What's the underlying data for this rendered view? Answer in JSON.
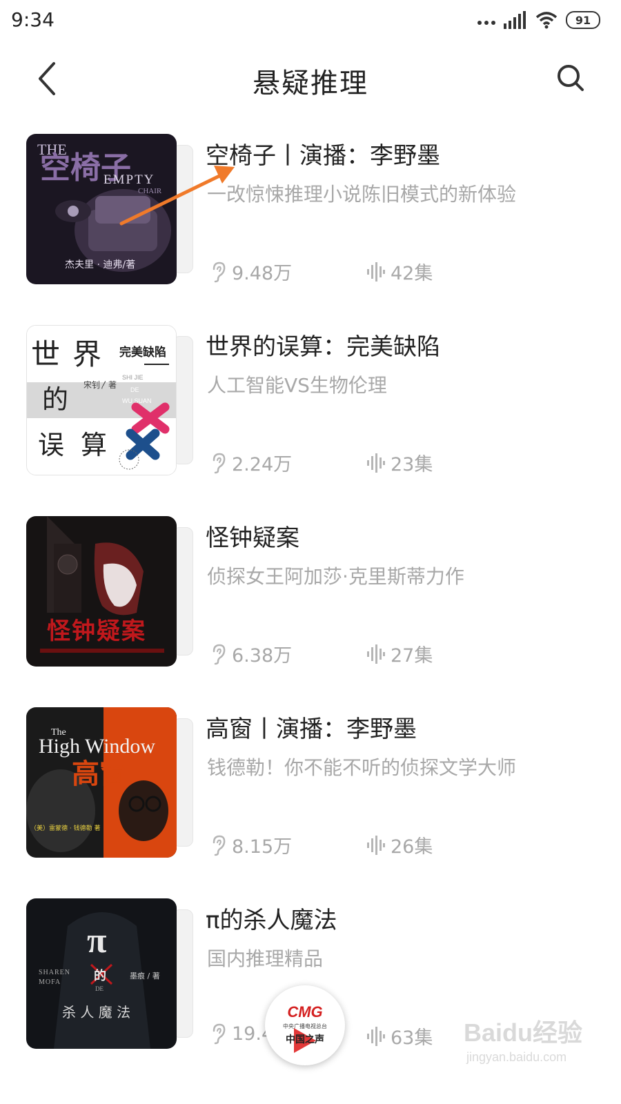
{
  "status_bar": {
    "time": "9:34",
    "battery": "91"
  },
  "header": {
    "title": "悬疑推理"
  },
  "books": [
    {
      "title": "空椅子丨演播：李野墨",
      "desc": "一改惊悚推理小说陈旧模式的新体验",
      "listens": "9.48万",
      "episodes": "42集",
      "cover": {
        "title": "空椅子",
        "en_line1": "THE",
        "en_line2": "EMPTY",
        "en_line3": "CHAIR",
        "author": "杰夫里 · 迪弗/著",
        "bg": "#1b1622",
        "accent": "#8a6ea6"
      }
    },
    {
      "title": "世界的误算：完美缺陷",
      "desc": "人工智能VS生物伦理",
      "listens": "2.24万",
      "episodes": "23集",
      "cover": {
        "c1": "世",
        "c2": "界",
        "c3": "的",
        "c4": "误",
        "c5": "算",
        "subtitle": "完美缺陷",
        "author": "宋钊〳著",
        "pinyin1": "SHI JIE",
        "pinyin2": "DE",
        "pinyin3": "WU SUAN",
        "bg": "#ffffff",
        "accent": "#e0306a",
        "accent2": "#1d4f8c"
      }
    },
    {
      "title": "怪钟疑案",
      "desc": "侦探女王阿加莎·克里斯蒂力作",
      "listens": "6.38万",
      "episodes": "27集",
      "cover": {
        "title": "怪钟疑案",
        "bg": "#161313",
        "accent": "#c0181c"
      }
    },
    {
      "title": "高窗丨演播：李野墨",
      "desc": "钱德勒！你不能不听的侦探文学大师",
      "listens": "8.15万",
      "episodes": "26集",
      "cover": {
        "en_the": "The",
        "en_title": "High Window",
        "title": "高窗",
        "author": "（美）雷蒙德 · 钱德勒 著",
        "bg": "#1a1a1a",
        "accent": "#d9460f"
      }
    },
    {
      "title": "π的杀人魔法",
      "desc": "国内推理精品",
      "listens": "19.4",
      "episodes": "63集",
      "cover": {
        "pi": "π",
        "de": "的",
        "de_en": "DE",
        "title": "杀 人 魔 法",
        "author": "墨痕 / 著",
        "en1": "SHAREN",
        "en2": "MOFA",
        "bg": "#121418",
        "accent": "#c0181c"
      }
    }
  ],
  "player": {
    "logo": "CMG",
    "sub": "中央广播电视总台",
    "name": "中国之声"
  },
  "watermark": {
    "main": "Baidu经验",
    "sub": "jingyan.baidu.com"
  },
  "colors": {
    "annotation_arrow": "#f07a2a",
    "muted_text": "#a8a8a8"
  }
}
